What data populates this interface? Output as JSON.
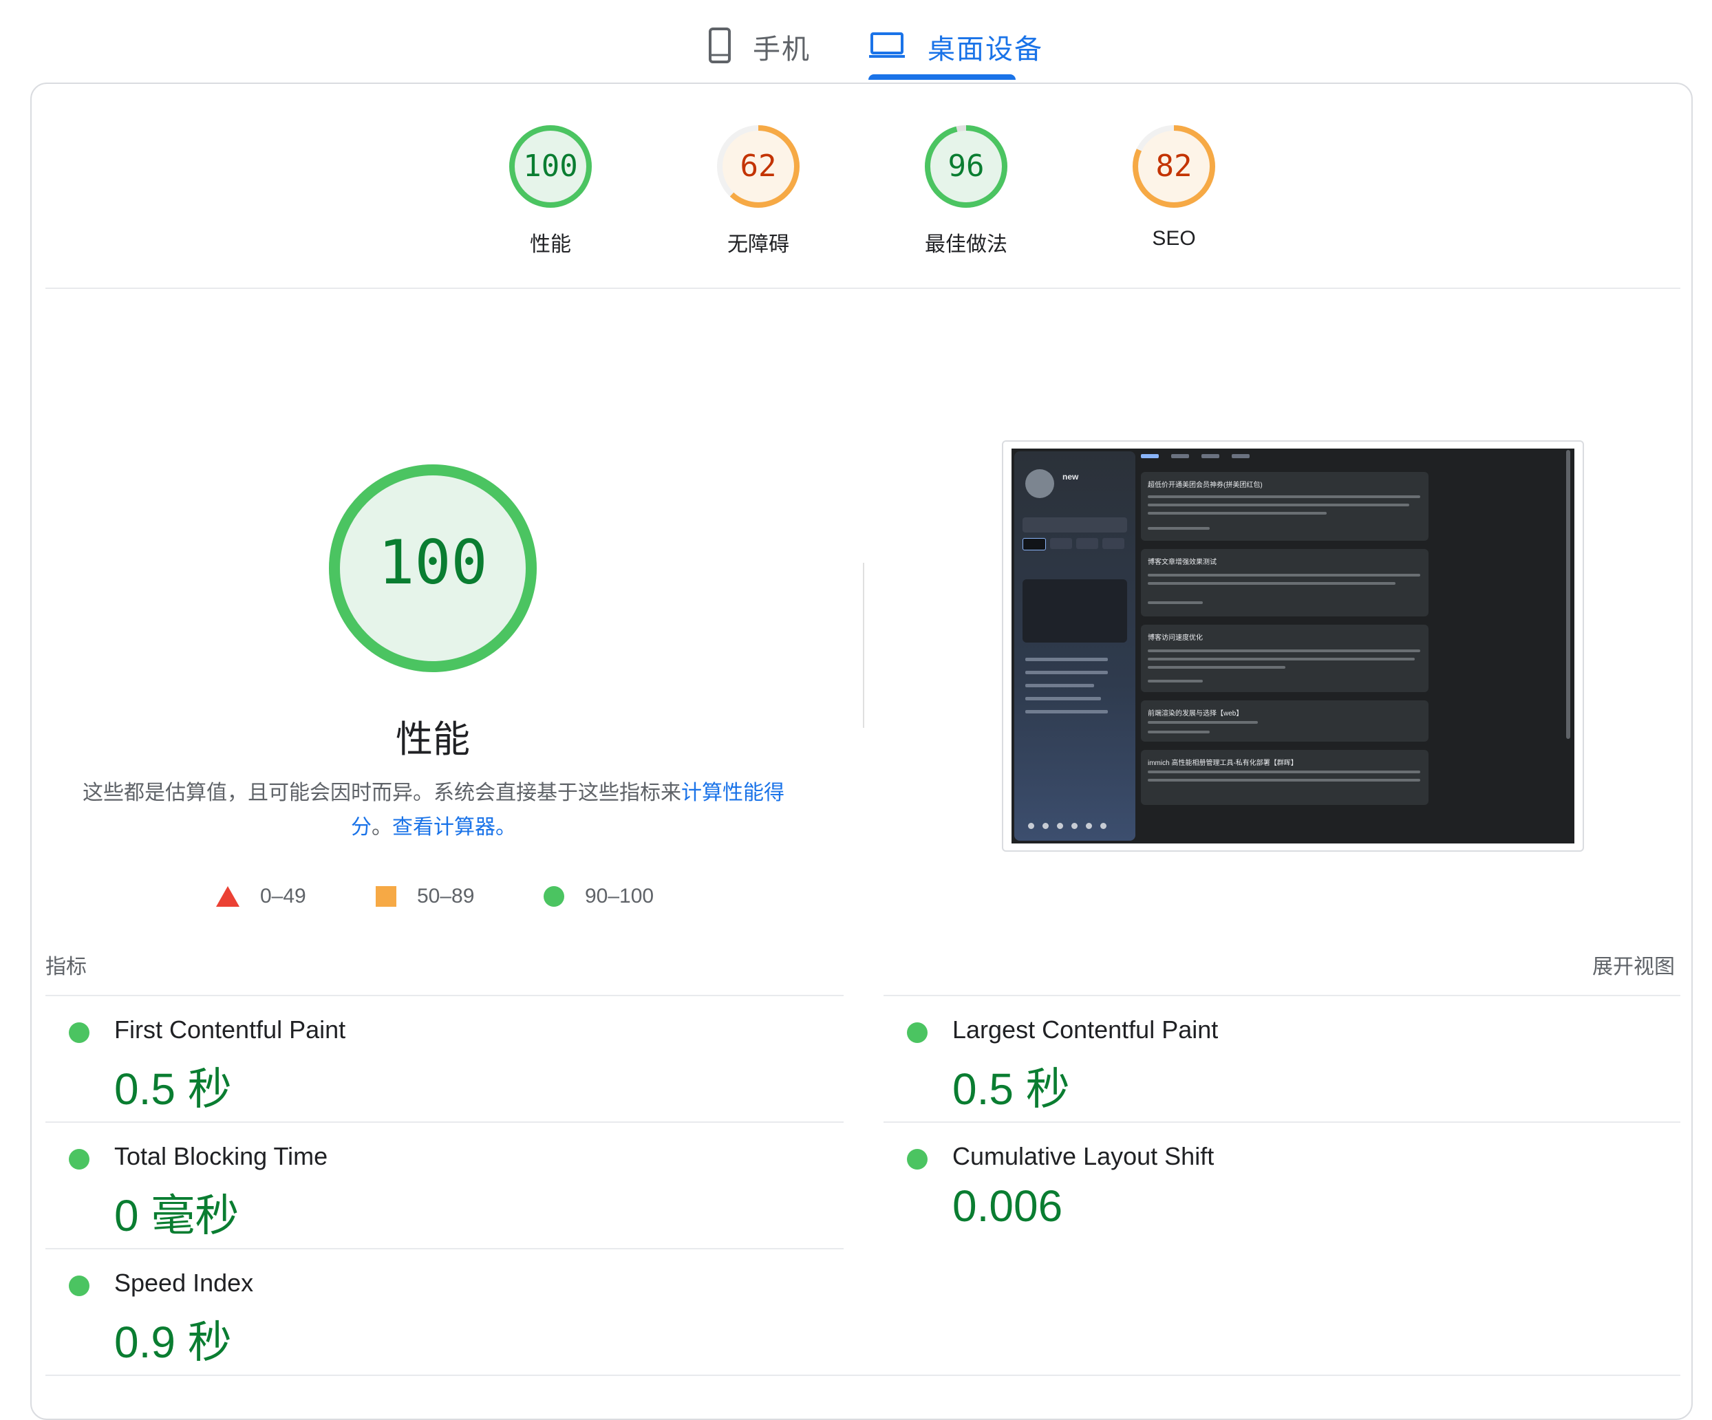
{
  "tabs": {
    "mobile_label": "手机",
    "desktop_label": "桌面设备"
  },
  "gauges": [
    {
      "name": "performance",
      "score": "100",
      "label": "性能",
      "rating": "pass"
    },
    {
      "name": "accessibility",
      "score": "62",
      "label": "无障碍",
      "rating": "average"
    },
    {
      "name": "best-practices",
      "score": "96",
      "label": "最佳做法",
      "rating": "pass"
    },
    {
      "name": "seo",
      "score": "82",
      "label": "SEO",
      "rating": "average"
    }
  ],
  "performance": {
    "score": "100",
    "title": "性能",
    "description_prefix": "这些都是估算值，且可能会因时而异。系统会直接基于这些指标来",
    "calc_link": "计算性能得分",
    "description_mid": "。",
    "calculator_link": "查看计算器。"
  },
  "legend": {
    "fail": "0–49",
    "average": "50–89",
    "pass": "90–100"
  },
  "thumbnail": {
    "site_title": "new",
    "post_titles": [
      "超低价开通美团会员神券(拼美团红包)",
      "博客文章增强效果测试",
      "博客访问速度优化",
      "前端渲染的发展与选择【web】",
      "immich 高性能相册管理工具-私有化部署【群晖】"
    ]
  },
  "metrics_section": {
    "header": "指标",
    "expand_label": "展开视图"
  },
  "metrics": {
    "fcp": {
      "name": "First Contentful Paint",
      "value": "0.5 秒"
    },
    "lcp": {
      "name": "Largest Contentful Paint",
      "value": "0.5 秒"
    },
    "tbt": {
      "name": "Total Blocking Time",
      "value": "0 毫秒"
    },
    "cls": {
      "name": "Cumulative Layout Shift",
      "value": "0.006"
    },
    "si": {
      "name": "Speed Index",
      "value": "0.9 秒"
    }
  },
  "colors": {
    "pass": "#0a7d31",
    "pass_ring": "#4bc461",
    "average": "#c33300",
    "average_ring": "#f6a945",
    "fail": "#eb4134",
    "accent": "#1a73e8"
  },
  "scores_fraction": {
    "performance": 1.0,
    "accessibility": 0.62,
    "best_practices": 0.96,
    "seo": 0.82
  }
}
